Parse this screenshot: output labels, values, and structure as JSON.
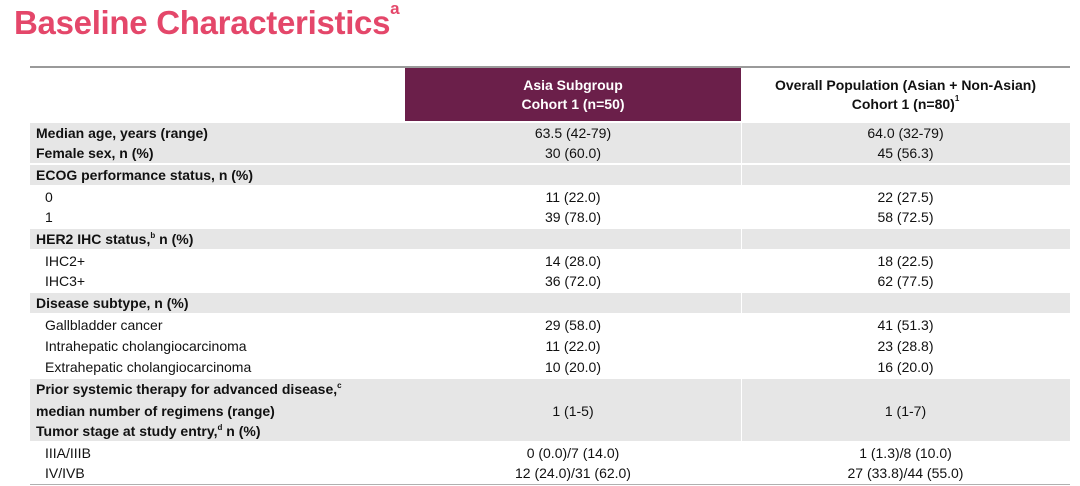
{
  "title": {
    "text": "Baseline Characteristics",
    "sup": "a"
  },
  "header": {
    "asia_line1": "Asia Subgroup",
    "asia_line2": "Cohort 1 (n=50)",
    "overall_line1": "Overall Population (Asian + Non-Asian)",
    "overall_line2": "Cohort 1 (n=80)",
    "overall_sup": "1"
  },
  "rows": [
    {
      "label": "Median age, years (range)",
      "v1": "63.5 (42-79)",
      "v2": "64.0 (32-79)"
    },
    {
      "label": "Female sex, n (%)",
      "v1": "30 (60.0)",
      "v2": "45 (56.3)"
    },
    {
      "label": "ECOG performance status, n (%)",
      "v1": "",
      "v2": ""
    },
    {
      "label": "0",
      "v1": "11 (22.0)",
      "v2": "22 (27.5)"
    },
    {
      "label": "1",
      "v1": "39 (78.0)",
      "v2": "58 (72.5)"
    },
    {
      "label_pre": "HER2 IHC status,",
      "label_sup": "b",
      "label_post": " n (%)",
      "v1": "",
      "v2": ""
    },
    {
      "label": "IHC2+",
      "v1": "14 (28.0)",
      "v2": "18 (22.5)"
    },
    {
      "label": "IHC3+",
      "v1": "36 (72.0)",
      "v2": "62 (77.5)"
    },
    {
      "label": "Disease subtype, n (%)",
      "v1": "",
      "v2": ""
    },
    {
      "label": "Gallbladder cancer",
      "v1": "29 (58.0)",
      "v2": "41 (51.3)"
    },
    {
      "label": "Intrahepatic cholangiocarcinoma",
      "v1": "11 (22.0)",
      "v2": "23 (28.8)"
    },
    {
      "label": "Extrahepatic cholangiocarcinoma",
      "v1": "10 (20.0)",
      "v2": "16 (20.0)"
    },
    {
      "label_pre": "Prior systemic therapy for advanced disease,",
      "label_sup": "c",
      "label_post": "",
      "v1": "",
      "v2": ""
    },
    {
      "label": "median number of regimens (range)",
      "v1": "1 (1-5)",
      "v2": "1 (1-7)"
    },
    {
      "label_pre": "Tumor stage at study entry,",
      "label_sup": "d",
      "label_post": " n (%)",
      "v1": "",
      "v2": ""
    },
    {
      "label": "IIIA/IIIB",
      "v1": "0 (0.0)/7 (14.0)",
      "v2": "1 (1.3)/8 (10.0)"
    },
    {
      "label": "IV/IVB",
      "v1": "12 (24.0)/31 (62.0)",
      "v2": "27 (33.8)/44 (55.0)"
    }
  ]
}
